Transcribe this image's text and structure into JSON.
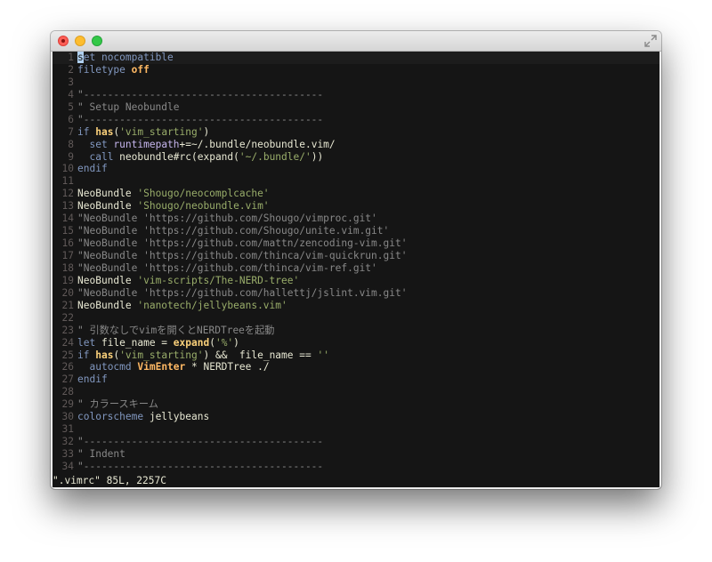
{
  "window": {
    "background": "#151515"
  },
  "lines": [
    {
      "n": "1",
      "tokens": [
        {
          "c": "cursor",
          "t": "s"
        },
        {
          "c": "t-kw",
          "t": "et nocompatible"
        }
      ],
      "cursorline": true
    },
    {
      "n": "2",
      "tokens": [
        {
          "c": "t-kw",
          "t": "filetype "
        },
        {
          "c": "t-opt t-bold",
          "t": "off"
        }
      ]
    },
    {
      "n": "3",
      "tokens": []
    },
    {
      "n": "4",
      "tokens": [
        {
          "c": "t-com",
          "t": "\"----------------------------------------"
        }
      ]
    },
    {
      "n": "5",
      "tokens": [
        {
          "c": "t-com",
          "t": "\" Setup Neobundle"
        }
      ]
    },
    {
      "n": "6",
      "tokens": [
        {
          "c": "t-com",
          "t": "\"----------------------------------------"
        }
      ]
    },
    {
      "n": "7",
      "tokens": [
        {
          "c": "t-kw",
          "t": "if "
        },
        {
          "c": "t-func t-bold",
          "t": "has"
        },
        {
          "c": "t-plain",
          "t": "("
        },
        {
          "c": "t-str",
          "t": "'vim_starting'"
        },
        {
          "c": "t-plain",
          "t": ")"
        }
      ]
    },
    {
      "n": "8",
      "tokens": [
        {
          "c": "t-plain",
          "t": "  "
        },
        {
          "c": "t-kw",
          "t": "set "
        },
        {
          "c": "t-var",
          "t": "runtimepath"
        },
        {
          "c": "t-plain",
          "t": "+=~/.bundle/neobundle.vim/"
        }
      ]
    },
    {
      "n": "9",
      "tokens": [
        {
          "c": "t-plain",
          "t": "  "
        },
        {
          "c": "t-kw",
          "t": "call "
        },
        {
          "c": "t-plain",
          "t": "neobundle#rc(expand("
        },
        {
          "c": "t-str",
          "t": "'~/.bundle/'"
        },
        {
          "c": "t-plain",
          "t": "))"
        }
      ]
    },
    {
      "n": "10",
      "tokens": [
        {
          "c": "t-kw",
          "t": "endif"
        }
      ]
    },
    {
      "n": "11",
      "tokens": []
    },
    {
      "n": "12",
      "tokens": [
        {
          "c": "t-plain",
          "t": "NeoBundle "
        },
        {
          "c": "t-str",
          "t": "'Shougo/neocomplcache'"
        }
      ]
    },
    {
      "n": "13",
      "tokens": [
        {
          "c": "t-plain",
          "t": "NeoBundle "
        },
        {
          "c": "t-str",
          "t": "'Shougo/neobundle.vim'"
        }
      ]
    },
    {
      "n": "14",
      "tokens": [
        {
          "c": "t-com",
          "t": "\"NeoBundle 'https://github.com/Shougo/vimproc.git'"
        }
      ]
    },
    {
      "n": "15",
      "tokens": [
        {
          "c": "t-com",
          "t": "\"NeoBundle 'https://github.com/Shougo/unite.vim.git'"
        }
      ]
    },
    {
      "n": "16",
      "tokens": [
        {
          "c": "t-com",
          "t": "\"NeoBundle 'https://github.com/mattn/zencoding-vim.git'"
        }
      ]
    },
    {
      "n": "17",
      "tokens": [
        {
          "c": "t-com",
          "t": "\"NeoBundle 'https://github.com/thinca/vim-quickrun.git'"
        }
      ]
    },
    {
      "n": "18",
      "tokens": [
        {
          "c": "t-com",
          "t": "\"NeoBundle 'https://github.com/thinca/vim-ref.git'"
        }
      ]
    },
    {
      "n": "19",
      "tokens": [
        {
          "c": "t-plain",
          "t": "NeoBundle "
        },
        {
          "c": "t-str",
          "t": "'vim-scripts/The-NERD-tree'"
        }
      ]
    },
    {
      "n": "20",
      "tokens": [
        {
          "c": "t-com",
          "t": "\"NeoBundle 'https://github.com/hallettj/jslint.vim.git'"
        }
      ]
    },
    {
      "n": "21",
      "tokens": [
        {
          "c": "t-plain",
          "t": "NeoBundle "
        },
        {
          "c": "t-str",
          "t": "'nanotech/jellybeans.vim'"
        }
      ]
    },
    {
      "n": "22",
      "tokens": []
    },
    {
      "n": "23",
      "tokens": [
        {
          "c": "t-com",
          "t": "\" 引数なしでvimを開くとNERDTreeを起動"
        }
      ]
    },
    {
      "n": "24",
      "tokens": [
        {
          "c": "t-kw",
          "t": "let "
        },
        {
          "c": "t-plain",
          "t": "file_name = "
        },
        {
          "c": "t-func t-bold",
          "t": "expand"
        },
        {
          "c": "t-plain",
          "t": "("
        },
        {
          "c": "t-str",
          "t": "'%'"
        },
        {
          "c": "t-plain",
          "t": ")"
        }
      ]
    },
    {
      "n": "25",
      "tokens": [
        {
          "c": "t-kw",
          "t": "if "
        },
        {
          "c": "t-func t-bold",
          "t": "has"
        },
        {
          "c": "t-plain",
          "t": "("
        },
        {
          "c": "t-str",
          "t": "'vim_starting'"
        },
        {
          "c": "t-plain",
          "t": ") &&  file_name == "
        },
        {
          "c": "t-str",
          "t": "''"
        }
      ]
    },
    {
      "n": "26",
      "tokens": [
        {
          "c": "t-plain",
          "t": "  "
        },
        {
          "c": "t-kw",
          "t": "autocmd "
        },
        {
          "c": "t-opt t-bold",
          "t": "VimEnter"
        },
        {
          "c": "t-plain",
          "t": " * NERDTree ./"
        }
      ]
    },
    {
      "n": "27",
      "tokens": [
        {
          "c": "t-kw",
          "t": "endif"
        }
      ]
    },
    {
      "n": "28",
      "tokens": []
    },
    {
      "n": "29",
      "tokens": [
        {
          "c": "t-com",
          "t": "\" カラースキーム"
        }
      ]
    },
    {
      "n": "30",
      "tokens": [
        {
          "c": "t-kw",
          "t": "colorscheme "
        },
        {
          "c": "t-plain",
          "t": "jellybeans"
        }
      ]
    },
    {
      "n": "31",
      "tokens": []
    },
    {
      "n": "32",
      "tokens": [
        {
          "c": "t-com",
          "t": "\"----------------------------------------"
        }
      ]
    },
    {
      "n": "33",
      "tokens": [
        {
          "c": "t-com",
          "t": "\" Indent"
        }
      ]
    },
    {
      "n": "34",
      "tokens": [
        {
          "c": "t-com",
          "t": "\"----------------------------------------"
        }
      ]
    }
  ],
  "status": "\".vimrc\" 85L, 2257C"
}
